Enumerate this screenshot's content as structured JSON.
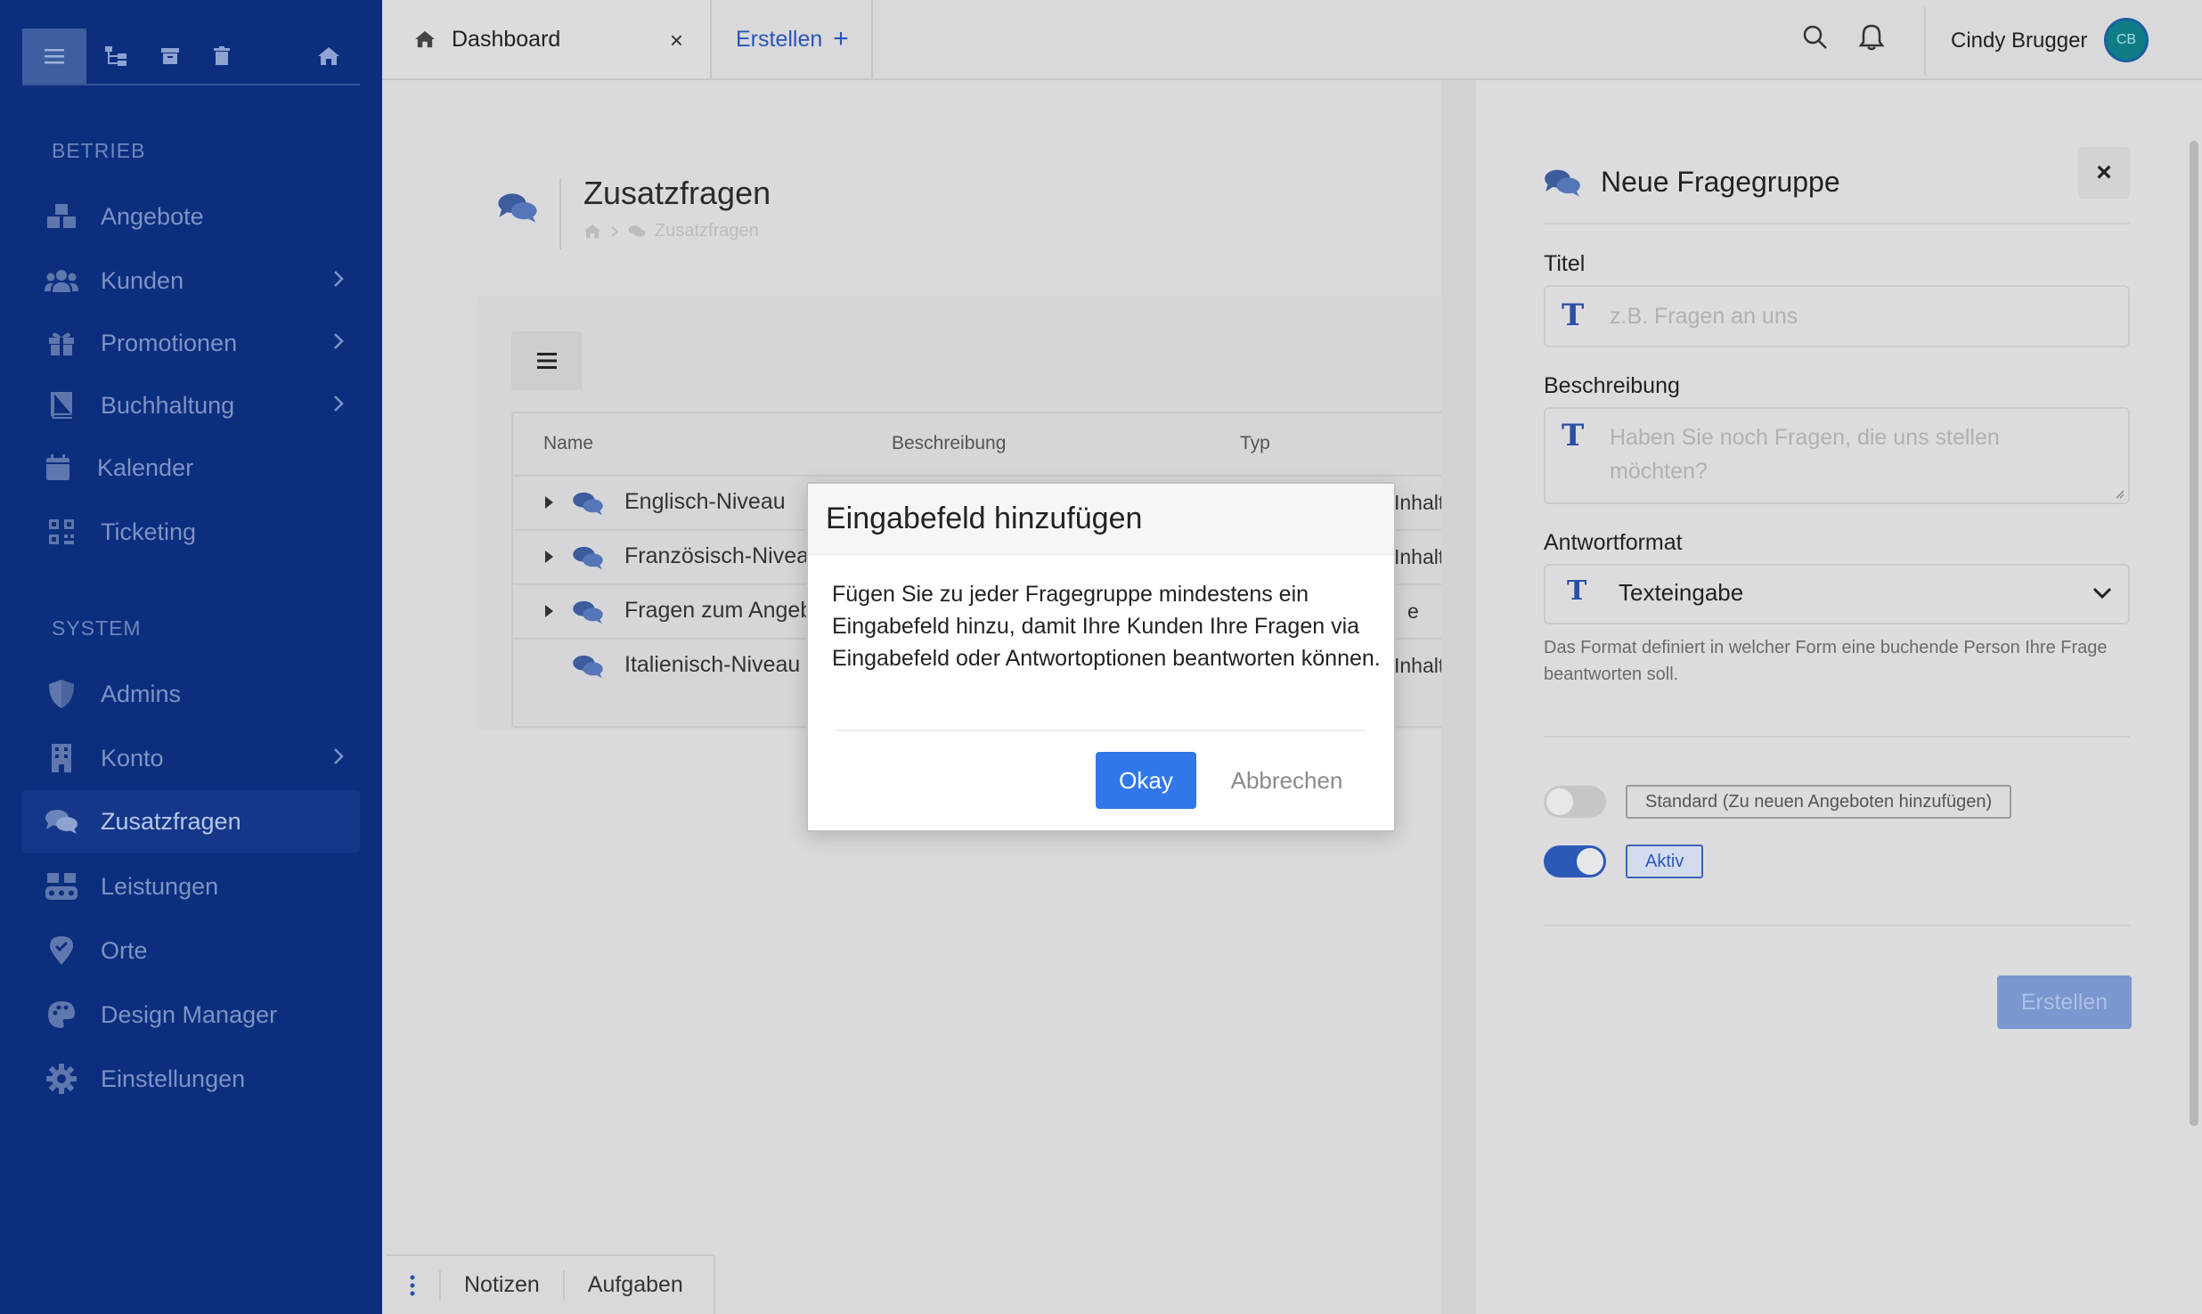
{
  "sidebar": {
    "section_betrieb": "BETRIEB",
    "section_system": "SYSTEM",
    "items": [
      {
        "label": "Angebote"
      },
      {
        "label": "Kunden"
      },
      {
        "label": "Promotionen"
      },
      {
        "label": "Buchhaltung"
      },
      {
        "label": "Kalender"
      },
      {
        "label": "Ticketing"
      },
      {
        "label": "Admins"
      },
      {
        "label": "Konto"
      },
      {
        "label": "Zusatzfragen"
      },
      {
        "label": "Leistungen"
      },
      {
        "label": "Orte"
      },
      {
        "label": "Design Manager"
      },
      {
        "label": "Einstellungen"
      }
    ]
  },
  "tabs": {
    "dashboard": "Dashboard",
    "create": "Erstellen",
    "create_plus": "+",
    "close": "×"
  },
  "user": {
    "name": "Cindy Brugger",
    "initials": "CB"
  },
  "page": {
    "title": "Zusatzfragen",
    "breadcrumb": "Zusatzfragen"
  },
  "table": {
    "columns": [
      "Name",
      "Beschreibung",
      "Typ"
    ],
    "rows": [
      {
        "name": "Englisch-Niveau",
        "typ": "Inhalte"
      },
      {
        "name": "Französisch-Niveau",
        "typ": "Inhalte"
      },
      {
        "name": "Fragen zum Angebot",
        "typ": "e"
      },
      {
        "name": "Italienisch-Niveau",
        "typ": "Inhalte"
      }
    ]
  },
  "bottombar": {
    "notes": "Notizen",
    "tasks": "Aufgaben"
  },
  "drawer": {
    "title": "Neue Fragegruppe",
    "close": "×",
    "title_label": "Titel",
    "title_placeholder": "z.B. Fragen an uns",
    "desc_label": "Beschreibung",
    "desc_placeholder": "Haben Sie noch Fragen, die uns stellen möchten?",
    "format_label": "Antwortformat",
    "format_value": "Texteingabe",
    "format_help": "Das Format definiert in welcher Form eine buchende Person Ihre Frage beantworten soll.",
    "toggle_standard_label": "Standard (Zu neuen Angeboten hinzufügen)",
    "toggle_standard_on": false,
    "toggle_active_label": "Aktiv",
    "toggle_active_on": true,
    "submit": "Erstellen"
  },
  "modal": {
    "title": "Eingabefeld hinzufügen",
    "body": "Fügen Sie zu jeder Fragegruppe mindestens ein Eingabefeld hinzu, damit Ihre Kunden Ihre Fragen via Eingabefeld oder Antwortoptionen beantworten können.",
    "ok": "Okay",
    "cancel": "Abbrechen"
  },
  "colors": {
    "sidebar_bg": "#0c2e7e",
    "accent": "#3177ea",
    "toggle_on": "#2c58b8"
  }
}
